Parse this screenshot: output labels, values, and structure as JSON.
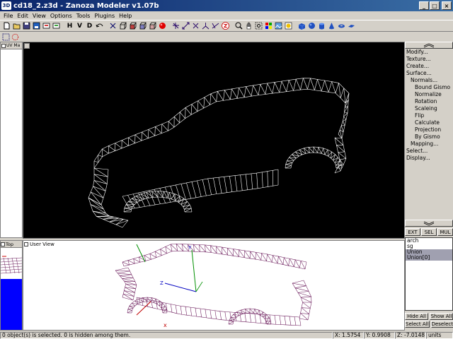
{
  "window": {
    "icon_text": "3D",
    "title": "cd18_2.z3d - Zanoza Modeler v1.07b",
    "min": "_",
    "max": "□",
    "close": "×"
  },
  "menu": [
    "File",
    "Edit",
    "View",
    "Options",
    "Tools",
    "Plugins",
    "Help"
  ],
  "toolbar": {
    "view_h": "H",
    "view_v": "V",
    "view_d": "D",
    "z_label": "Z",
    "icons": [
      "new-file-icon",
      "open-folder-icon",
      "save-icon",
      "save-as-icon",
      "import-icon",
      "export-icon",
      "undo-icon",
      "redo-icon",
      "cube-wire-icon",
      "cube-solid-icon",
      "sphere-red-icon"
    ]
  },
  "left_panel": {
    "tab_label": "UV Ma"
  },
  "main_view": {
    "background": "#000000",
    "mesh_color": "#ffffff"
  },
  "right_panel": {
    "commands": [
      {
        "label": "Modify...",
        "level": 0
      },
      {
        "label": "Texture...",
        "level": 0
      },
      {
        "label": "Create...",
        "level": 0
      },
      {
        "label": "Surface...",
        "level": 0
      },
      {
        "label": "Normals...",
        "level": 1
      },
      {
        "label": "Bound Gismo",
        "level": 2
      },
      {
        "label": "Normalize",
        "level": 2
      },
      {
        "label": "Rotation",
        "level": 2
      },
      {
        "label": "Scaleing",
        "level": 2
      },
      {
        "label": "Flip",
        "level": 2
      },
      {
        "label": "Calculate",
        "level": 2
      },
      {
        "label": "Projection",
        "level": 2
      },
      {
        "label": "By Gismo",
        "level": 2
      },
      {
        "label": "Mapping...",
        "level": 1
      },
      {
        "label": "Select...",
        "level": 0
      },
      {
        "label": "Display...",
        "level": 0
      }
    ],
    "tabs": [
      "EXT",
      "SEL",
      "MUL"
    ],
    "objects": [
      {
        "name": "arch",
        "selected": false
      },
      {
        "name": "sg",
        "selected": false
      },
      {
        "name": "Union",
        "selected": true
      },
      {
        "name": "Union[0]",
        "selected": true
      }
    ],
    "hide_all": "Hide All",
    "show_all": "Show All",
    "select_all": "Select All",
    "deselect": "Deselect"
  },
  "bottom_left": {
    "label": "Top"
  },
  "user_view": {
    "label": "User View",
    "mesh_color": "#6a1a5a",
    "axis_y_label": "Y",
    "axis_z_label": "Z",
    "axis_x_label": "x"
  },
  "status": {
    "message": "0 object(s) is selected. 0 is hidden among them.",
    "x": "X: 1.5754",
    "y": "Y: 0.9908",
    "z": "Z: -7.0148",
    "units": "units"
  }
}
